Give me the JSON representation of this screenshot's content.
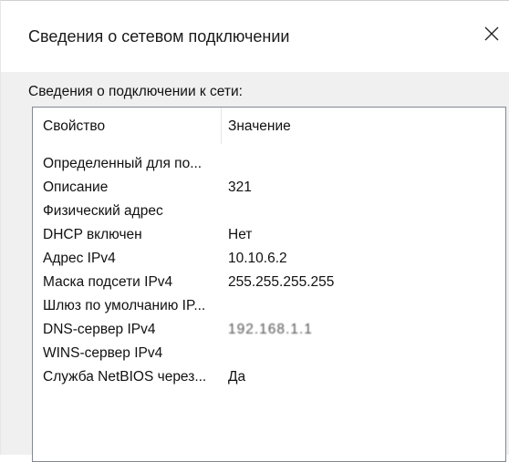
{
  "window": {
    "title": "Сведения о сетевом подключении",
    "close_icon": "close-icon"
  },
  "details": {
    "section_label": "Сведения о подключении к сети:",
    "columns": {
      "property": "Свойство",
      "value": "Значение"
    },
    "rows": [
      {
        "property": "Определенный для по...",
        "value": ""
      },
      {
        "property": "Описание",
        "value": "321"
      },
      {
        "property": "Физический адрес",
        "value": ""
      },
      {
        "property": "DHCP включен",
        "value": "Нет"
      },
      {
        "property": "Адрес IPv4",
        "value": "10.10.6.2"
      },
      {
        "property": "Маска подсети IPv4",
        "value": "255.255.255.255"
      },
      {
        "property": "Шлюз по умолчанию IP...",
        "value": ""
      },
      {
        "property": "DNS-сервер IPv4",
        "value": "192.168.1.1"
      },
      {
        "property": "WINS-сервер IPv4",
        "value": ""
      },
      {
        "property": "Служба NetBIOS через...",
        "value": "Да"
      }
    ]
  }
}
